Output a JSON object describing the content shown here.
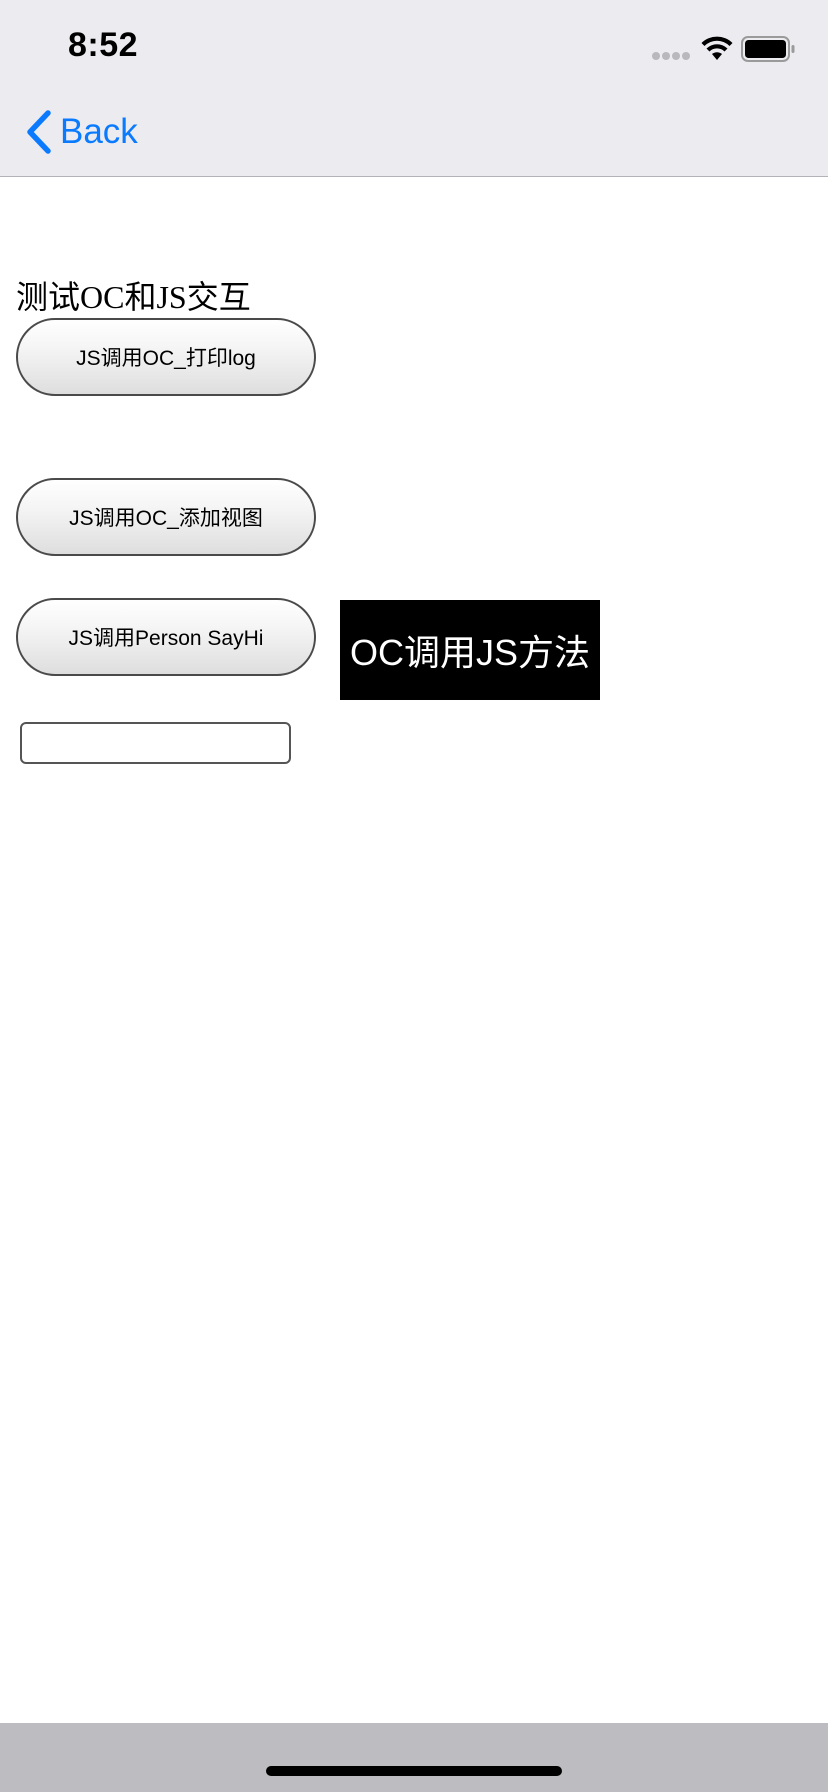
{
  "status_bar": {
    "time": "8:52"
  },
  "nav": {
    "back_label": "Back",
    "accent_color": "#0a7aff"
  },
  "web": {
    "title": "测试OC和JS交互",
    "buttons": [
      {
        "label": "JS调用OC_打印log"
      },
      {
        "label": "JS调用OC_添加视图"
      },
      {
        "label": "JS调用Person SayHi"
      }
    ],
    "oc_call_js_button": "OC调用JS方法",
    "text_field": {
      "value": "",
      "placeholder": ""
    }
  },
  "icons": {
    "signal": "cellular-signal-icon",
    "wifi": "wifi-icon",
    "battery": "battery-icon",
    "back": "chevron-left-icon"
  }
}
